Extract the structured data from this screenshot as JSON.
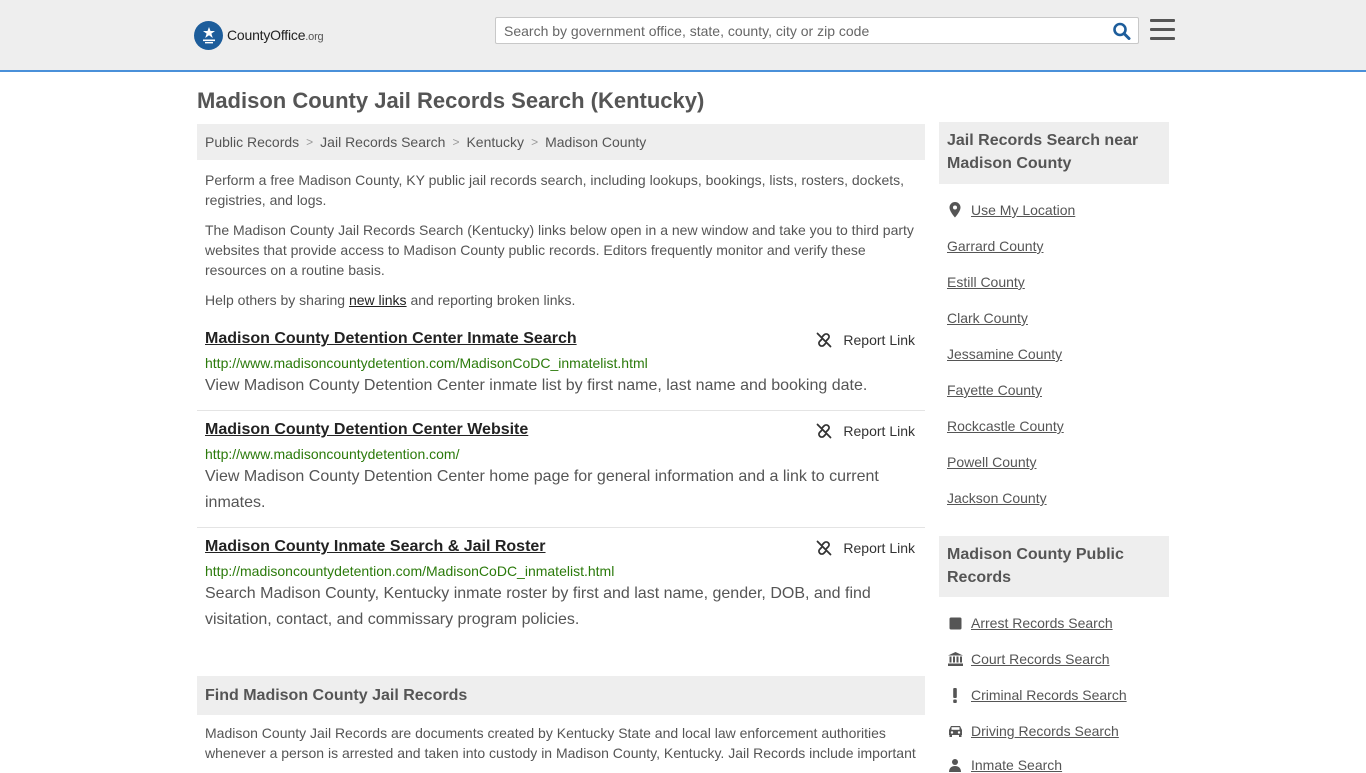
{
  "header": {
    "logo": {
      "brand_a": "County",
      "brand_b": "Office",
      "brand_c": ".org"
    },
    "search_placeholder": "Search by government office, state, county, city or zip code"
  },
  "page_title": "Madison County Jail Records Search (Kentucky)",
  "breadcrumb": [
    "Public Records",
    "Jail Records Search",
    "Kentucky",
    "Madison County"
  ],
  "intro": {
    "p1": "Perform a free Madison County, KY public jail records search, including lookups, bookings, lists, rosters, dockets, registries, and logs.",
    "p2": "The Madison County Jail Records Search (Kentucky) links below open in a new window and take you to third party websites that provide access to Madison County public records. Editors frequently monitor and verify these resources on a routine basis.",
    "p3_before": "Help others by sharing ",
    "p3_link": "new links",
    "p3_after": " and reporting broken links."
  },
  "report_label": "Report Link",
  "results": [
    {
      "title": "Madison County Detention Center Inmate Search",
      "url": "http://www.madisoncountydetention.com/MadisonCoDC_inmatelist.html",
      "desc": "View Madison County Detention Center inmate list by first name, last name and booking date."
    },
    {
      "title": "Madison County Detention Center Website",
      "url": "http://www.madisoncountydetention.com/",
      "desc": "View Madison County Detention Center home page for general information and a link to current inmates."
    },
    {
      "title": "Madison County Inmate Search & Jail Roster",
      "url": "http://madisoncountydetention.com/MadisonCoDC_inmatelist.html",
      "desc": "Search Madison County, Kentucky inmate roster by first and last name, gender, DOB, and find visitation, contact, and commissary program policies."
    }
  ],
  "find_section": {
    "heading": "Find Madison County Jail Records",
    "body": "Madison County Jail Records are documents created by Kentucky State and local law enforcement authorities whenever a person is arrested and taken into custody in Madison County, Kentucky. Jail Records include important"
  },
  "sidebar": {
    "nearby_heading": "Jail Records Search near Madison County",
    "use_location": "Use My Location",
    "nearby": [
      "Garrard County",
      "Estill County",
      "Clark County",
      "Jessamine County",
      "Fayette County",
      "Rockcastle County",
      "Powell County",
      "Jackson County"
    ],
    "public_heading": "Madison County Public Records",
    "public_links": [
      {
        "label": "Arrest Records Search",
        "icon": "square-icon"
      },
      {
        "label": "Court Records Search",
        "icon": "courthouse-icon"
      },
      {
        "label": "Criminal Records Search",
        "icon": "exclamation-icon"
      },
      {
        "label": "Driving Records Search",
        "icon": "car-icon"
      },
      {
        "label": "Inmate Search",
        "icon": "inmate-icon"
      }
    ]
  },
  "colors": {
    "header_bg": "#eeeeee",
    "header_border": "#4a90d9",
    "url_green": "#2b7a0b",
    "logo_blue": "#1d5d9b",
    "search_icon": "#1d5d9b"
  }
}
